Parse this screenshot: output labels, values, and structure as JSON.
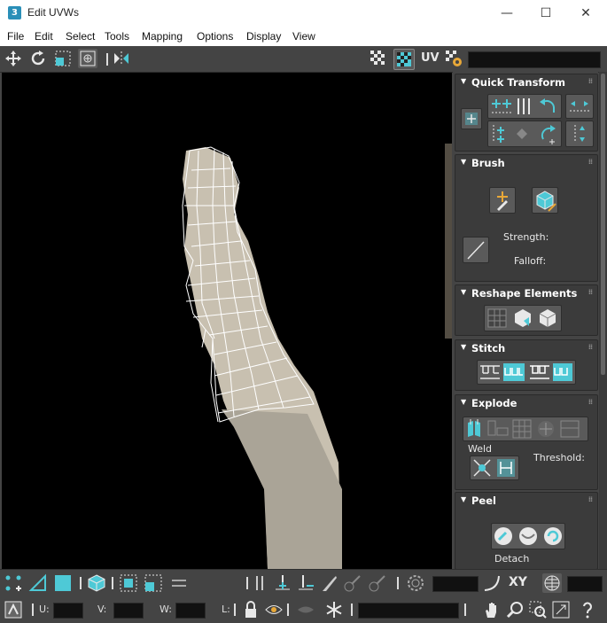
{
  "window": {
    "app_icon_text": "3",
    "title": "Edit UVWs",
    "minimize": "—",
    "maximize": "☐",
    "close": "✕"
  },
  "menu": {
    "items": [
      "File",
      "Edit",
      "Select",
      "Tools",
      "Mapping",
      "Options",
      "Display",
      "View"
    ]
  },
  "toolbar": {
    "uv_label": "UV"
  },
  "panel": {
    "quick_transform": {
      "title": "Quick Transform"
    },
    "brush": {
      "title": "Brush",
      "strength_label": "Strength:",
      "falloff_label": "Falloff:"
    },
    "reshape": {
      "title": "Reshape Elements"
    },
    "stitch": {
      "title": "Stitch"
    },
    "explode": {
      "title": "Explode",
      "weld_label": "Weld",
      "threshold_label": "Threshold:"
    },
    "peel": {
      "title": "Peel",
      "detach_label": "Detach"
    }
  },
  "bottom": {
    "xy_label": "XY",
    "u_label": "U:",
    "v_label": "V:",
    "w_label": "W:",
    "l_label": "L:"
  },
  "colors": {
    "accent": "#4ec9d6",
    "panel_bg": "#444444",
    "viewport_bg": "#000000"
  }
}
